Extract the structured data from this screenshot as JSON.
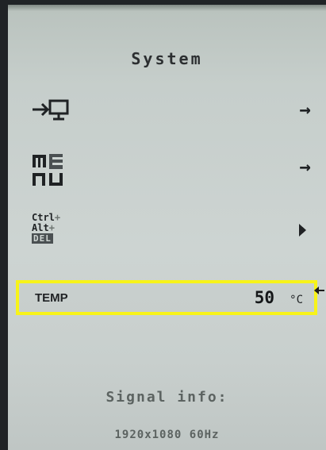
{
  "osd": {
    "title": "System",
    "items": [
      {
        "icon": "input-source-icon",
        "arrow": "→"
      },
      {
        "icon": "menu-icon",
        "arrow": "→"
      },
      {
        "icon": "ctrl-alt-del-icon",
        "ctrl": "Ctrl",
        "alt": "Alt",
        "plus": "+",
        "del": "DEL"
      }
    ],
    "temp": {
      "label": "TEMP",
      "value": "50",
      "unit": "°C"
    },
    "signal": {
      "label": "Signal info:",
      "value": "1920x1080 60Hz"
    }
  },
  "colors": {
    "highlight": "#f7f319",
    "text": "#1f2224",
    "muted": "#5c6361"
  }
}
